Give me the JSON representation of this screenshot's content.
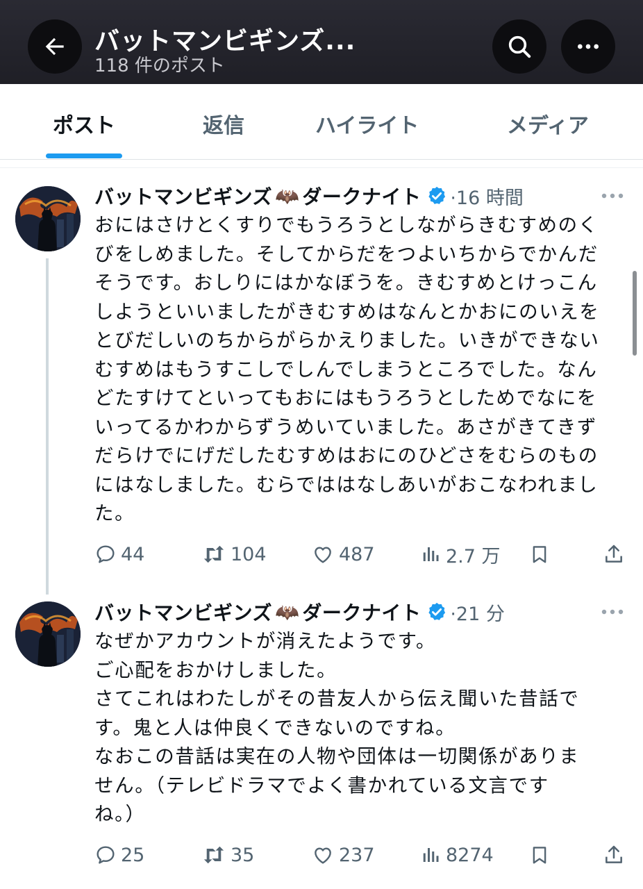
{
  "header": {
    "title": "バットマンビギンズ...",
    "subtitle": "118 件のポスト"
  },
  "tabs": [
    {
      "label": "ポスト",
      "active": true
    },
    {
      "label": "返信",
      "active": false
    },
    {
      "label": "ハイライト",
      "active": false
    },
    {
      "label": "メディア",
      "active": false
    }
  ],
  "accent_color": "#1d9bf0",
  "tweets": [
    {
      "name_a": "バットマンビギンズ",
      "name_emoji": "🦇",
      "name_b": "ダークナイト",
      "verified": true,
      "time": "·16 時間",
      "lines": [
        "おにはさけとくすりでもうろうとしながらきむすめのく",
        "びをしめました。そしてからだをつよいちからでかんだ",
        "そうです。おしりにはかなぼうを。きむすめとけっこん",
        "しようといいましたがきむすめはなんとかおにのいえを",
        "とびだしいのちからがらかえりました。いきができない",
        "むすめはもうすこしでしんでしまうところでした。なん",
        "どたすけてといってもおにはもうろうとしためでなにを",
        "いってるかわからずうめいていました。あさがきてきず",
        "だらけでにげだしたむすめはおにのひどさをむらのもの",
        "にはなしました。むらでははなしあいがおこなわれまし",
        "た。"
      ],
      "replies": "44",
      "reposts": "104",
      "likes": "487",
      "views": "2.7 万"
    },
    {
      "name_a": "バットマンビギンズ",
      "name_emoji": "🦇",
      "name_b": "ダークナイト",
      "verified": true,
      "time": "·21 分",
      "lines": [
        "なぜかアカウントが消えたようです。",
        "ご心配をおかけしました。",
        "さてこれはわたしがその昔友人から伝え聞いた昔話で",
        "す。鬼と人は仲良くできないのですね。",
        "なおこの昔話は実在の人物や団体は一切関係がありま",
        "せん。（テレビドラマでよく書かれている文言です",
        "ね。）"
      ],
      "replies": "25",
      "reposts": "35",
      "likes": "237",
      "views": "8274"
    }
  ]
}
